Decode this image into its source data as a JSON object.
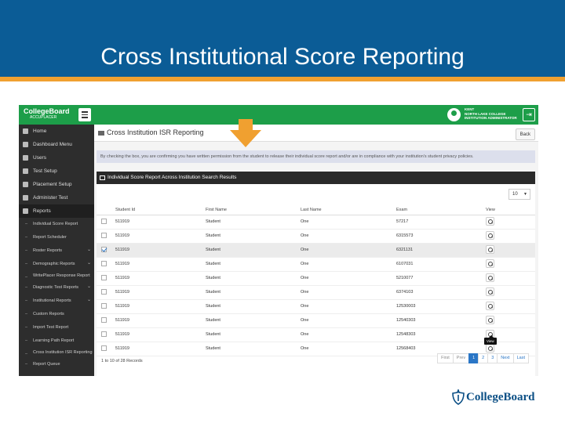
{
  "slide": {
    "title": "Cross Institutional Score Reporting"
  },
  "footer": {
    "logo_text": "CollegeBoard"
  },
  "app": {
    "brand": {
      "name": "CollegeBoard",
      "sub": "ACCUPLACER"
    },
    "user": {
      "line1": "KENT",
      "line2": "NORTH LAKE COLLEGE",
      "line3": "INSTITUTION ADMINISTRATOR"
    },
    "sidebar": {
      "items": [
        {
          "label": "Home",
          "icon": "home-icon"
        },
        {
          "label": "Dashboard Menu",
          "icon": "dashboard-icon"
        },
        {
          "label": "Users",
          "icon": "users-icon"
        },
        {
          "label": "Test Setup",
          "icon": "gear-icon"
        },
        {
          "label": "Placement Setup",
          "icon": "placement-icon"
        },
        {
          "label": "Administer Test",
          "icon": "edit-icon"
        },
        {
          "label": "Reports",
          "icon": "reports-icon"
        }
      ],
      "subitems": [
        {
          "label": "Individual Score Report",
          "chevron": false
        },
        {
          "label": "Report Scheduler",
          "chevron": false
        },
        {
          "label": "Roster Reports",
          "chevron": true
        },
        {
          "label": "Demographic Reports",
          "chevron": true
        },
        {
          "label": "WritePlacer Response Report",
          "chevron": false
        },
        {
          "label": "Diagnostic Test Reports",
          "chevron": true
        },
        {
          "label": "Institutional Reports",
          "chevron": true
        },
        {
          "label": "Custom Reports",
          "chevron": false
        },
        {
          "label": "Import Test Report",
          "chevron": false
        },
        {
          "label": "Learning Path Report",
          "chevron": false
        },
        {
          "label": "Cross Institution ISR Reporting",
          "chevron": false
        },
        {
          "label": "Report Queue",
          "chevron": false
        }
      ]
    },
    "page": {
      "title": "Cross Institution ISR Reporting",
      "back_label": "Back",
      "notice": "By checking the box, you are confirming you have written permission from the student to release their individual score report and/or are in compliance with your institution's student privacy policies.",
      "panel_title": "Individual Score Report Across Institution Search Results",
      "rows_per_page": "10"
    },
    "table": {
      "headers": [
        "",
        "Student Id",
        "First Name",
        "Last Name",
        "Exam",
        "View"
      ],
      "rows": [
        {
          "checked": false,
          "student_id": "511919",
          "first_name": "Student",
          "last_name": "One",
          "exam": "57217"
        },
        {
          "checked": false,
          "student_id": "511919",
          "first_name": "Student",
          "last_name": "One",
          "exam": "6315573"
        },
        {
          "checked": true,
          "student_id": "511919",
          "first_name": "Student",
          "last_name": "One",
          "exam": "6321131"
        },
        {
          "checked": false,
          "student_id": "511919",
          "first_name": "Student",
          "last_name": "One",
          "exam": "6107031"
        },
        {
          "checked": false,
          "student_id": "511919",
          "first_name": "Student",
          "last_name": "One",
          "exam": "5210077"
        },
        {
          "checked": false,
          "student_id": "511919",
          "first_name": "Student",
          "last_name": "One",
          "exam": "6374103"
        },
        {
          "checked": false,
          "student_id": "511919",
          "first_name": "Student",
          "last_name": "One",
          "exam": "12530003"
        },
        {
          "checked": false,
          "student_id": "511919",
          "first_name": "Student",
          "last_name": "One",
          "exam": "12540303"
        },
        {
          "checked": false,
          "student_id": "511919",
          "first_name": "Student",
          "last_name": "One",
          "exam": "12548303"
        },
        {
          "checked": false,
          "student_id": "511919",
          "first_name": "Student",
          "last_name": "One",
          "exam": "12568403"
        }
      ],
      "tooltip": "View",
      "records_text": "1 to 10 of 28 Records"
    },
    "pagination": [
      "First",
      "Prev",
      "1",
      "2",
      "3",
      "Next",
      "Last"
    ],
    "pagination_current": "1"
  },
  "colors": {
    "header_blue": "#0b5c96",
    "accent_orange": "#f0a030",
    "app_green": "#1d9e49",
    "sidebar_dark": "#2d2d2d",
    "link_blue": "#2a76c6"
  }
}
